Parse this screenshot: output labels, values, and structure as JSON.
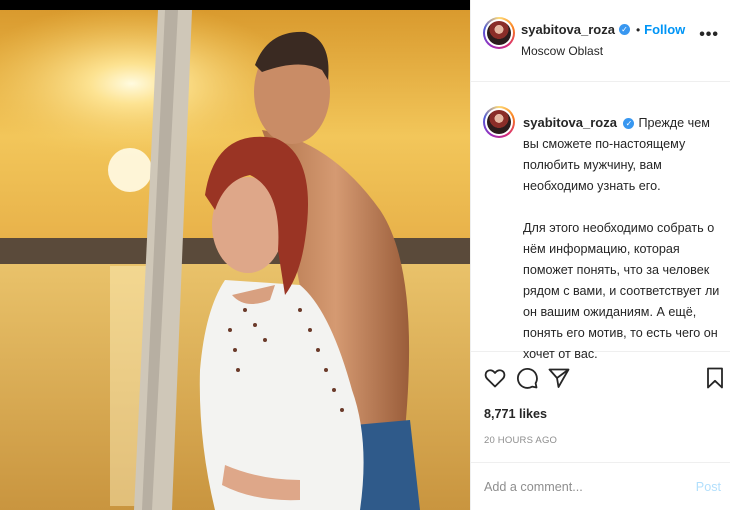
{
  "post": {
    "username": "syabitova_roza",
    "follow_label": "Follow",
    "separator": "•",
    "location": "Moscow Oblast",
    "more_label": "•••",
    "caption_para1": "Прежде чем вы сможете по-настоящему полюбить мужчину, вам необходимо узнать его.",
    "caption_para2": "Для этого необходимо собрать о нём информацию, которая поможет понять, что за человек рядом с вами, и соответствует ли он вашим ожиданиям. А ещё, понять его мотив, то есть чего он хочет от вас.",
    "likes": "8,771 likes",
    "time": "20 HOURS AGO"
  },
  "comment": {
    "placeholder": "Add a comment...",
    "post_label": "Post"
  },
  "icons": {
    "verified": "verified-badge-icon",
    "like": "heart-icon",
    "comment": "comment-bubble-icon",
    "share": "paper-plane-icon",
    "save": "bookmark-icon",
    "more": "more-options-icon"
  },
  "colors": {
    "accent": "#0095f6",
    "verified": "#3897f0",
    "post_disabled": "#b2dffc",
    "muted": "#8e8e8e"
  }
}
